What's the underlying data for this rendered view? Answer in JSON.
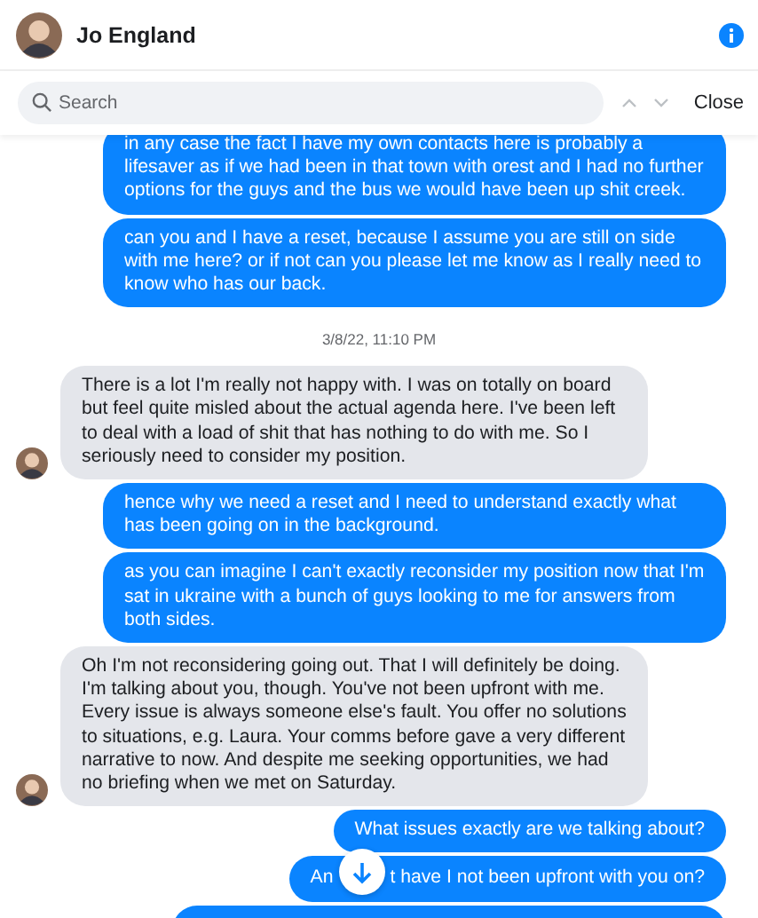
{
  "contact": {
    "name": "Jo England"
  },
  "search": {
    "placeholder": "Search",
    "close_label": "Close"
  },
  "messages": [
    {
      "kind": "sent",
      "text": "in any case the fact I have my own contacts here is probably a lifesaver as if we had been in that town with orest and I had no further options for the guys and the bus we would have been up shit creek."
    },
    {
      "kind": "sent",
      "text": "can you and I have a reset, because I assume you are still on side with me here? or if not can you please let me know as I really need to know who has our back."
    },
    {
      "kind": "timestamp",
      "text": "3/8/22, 11:10 PM"
    },
    {
      "kind": "received",
      "text": "There is a lot I'm really not happy with. I was on totally on board but feel quite misled about the actual agenda here. I've been left to deal with a load of shit that has nothing to do with me. So I seriously need to consider my position."
    },
    {
      "kind": "sent",
      "text": "hence why we need a reset and I need to understand exactly what has been going on in the background."
    },
    {
      "kind": "sent",
      "text": "as you can imagine I can't exactly reconsider my position now that I'm sat in ukraine with a bunch of guys looking to me for answers from both sides."
    },
    {
      "kind": "received",
      "text": "Oh I'm not reconsidering going out. That I will definitely be doing. I'm talking about you, though. You've not been upfront with me. Every issue is always someone else's fault. You offer no solutions to situations, e.g. Laura. Your comms before gave a very different narrative to now. And despite me seeking opportunities, we had no briefing when we met on Saturday."
    },
    {
      "kind": "sent",
      "text": "What issues exactly are we talking about?"
    },
    {
      "kind": "covered",
      "parts": [
        "An",
        "t have I not been upfront with you on?"
      ]
    },
    {
      "kind": "partial"
    }
  ]
}
